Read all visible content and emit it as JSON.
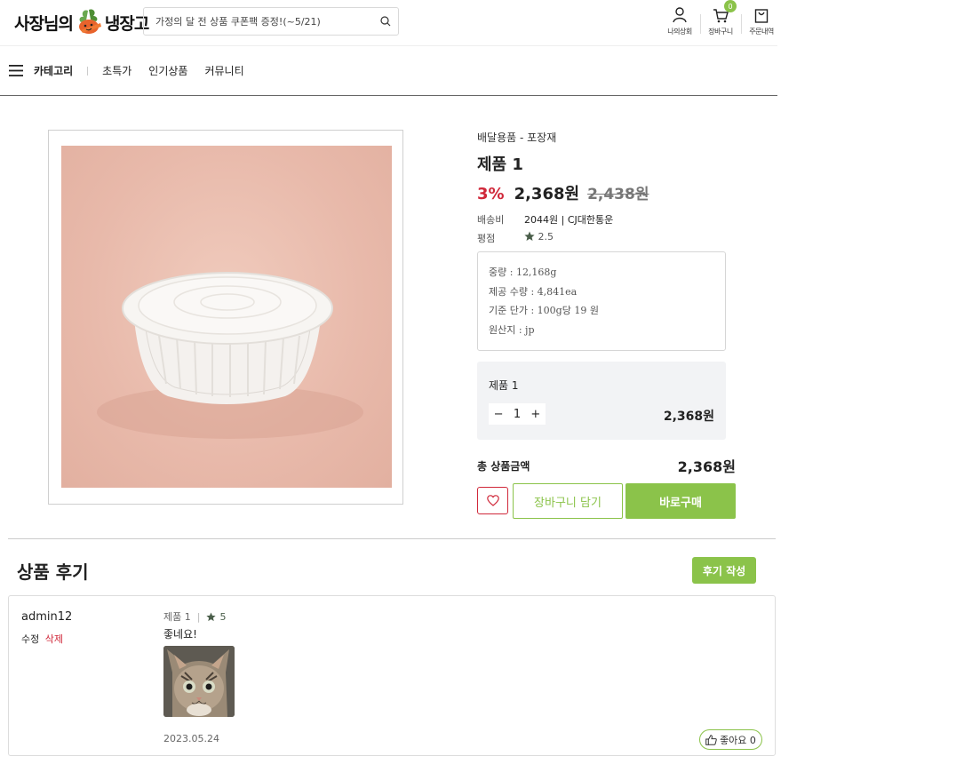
{
  "header": {
    "logo_left": "사장님의",
    "logo_right": "냉장고",
    "search_placeholder": "가정의 달 전 상품 쿠폰팩 증정!(~5/21)",
    "links": [
      {
        "label": "나의상회",
        "icon": "user-icon"
      },
      {
        "label": "장바구니",
        "icon": "cart-icon",
        "badge": "0"
      },
      {
        "label": "주문내역",
        "icon": "bag-icon"
      }
    ]
  },
  "nav": {
    "category_label": "카테고리",
    "items": [
      "초특가",
      "인기상품",
      "커뮤니티"
    ]
  },
  "product": {
    "breadcrumb": "배달용품 - 포장재",
    "name": "제품 1",
    "discount": "3%",
    "price": "2,368원",
    "original_price": "2,438원",
    "shipping_label": "배송비",
    "shipping_value": "2044원 | CJ대한통운",
    "rating_label": "평점",
    "rating_value": "2.5",
    "specs": [
      "중량 : 12,168g",
      "제공 수량 : 4,841ea",
      "기준 단가 : 100g당 19 원",
      "원산지 : jp"
    ],
    "option": {
      "name": "제품 1",
      "minus": "−",
      "quantity": "1",
      "plus": "+",
      "price": "2,368원"
    },
    "total_label": "총 상품금액",
    "total_price": "2,368원",
    "cart_button": "장바구니 담기",
    "buy_button": "바로구매"
  },
  "reviews": {
    "title": "상품 후기",
    "write_button": "후기 작성",
    "items": [
      {
        "user": "admin12",
        "edit": "수정",
        "delete": "삭제",
        "product": "제품 1",
        "stars": "5",
        "text": "좋네요!",
        "date": "2023.05.24",
        "like_label": "좋아요 0"
      }
    ]
  },
  "colors": {
    "accent": "#8bc34a",
    "sale": "#d0283a"
  }
}
